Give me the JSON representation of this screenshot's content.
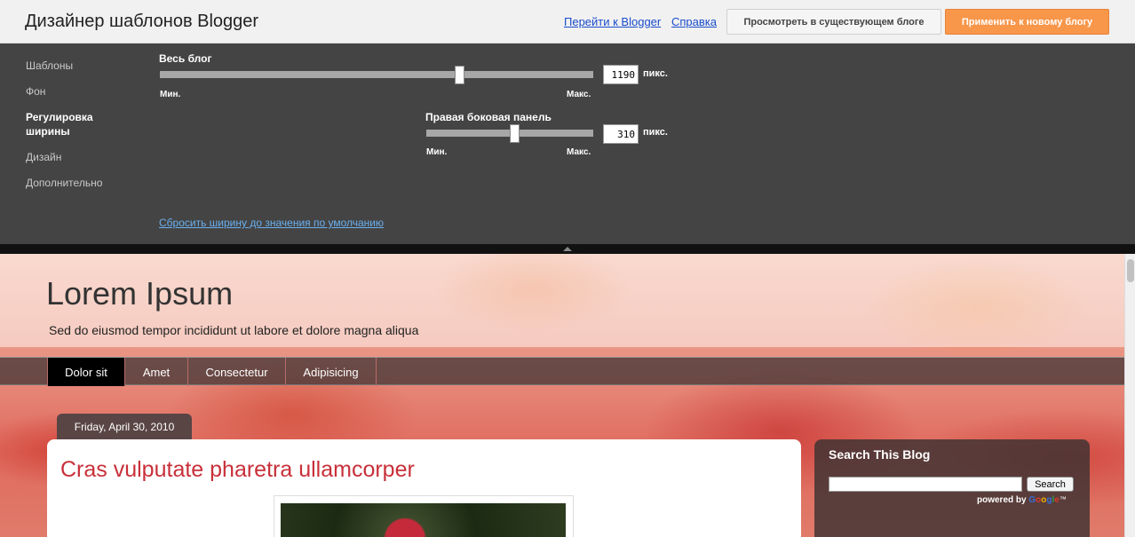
{
  "app": {
    "title_main": "Дизайнер шаблонов",
    "title_brand": "Blogger",
    "link_goto": "Перейти к Blogger",
    "link_help": "Справка",
    "btn_view": "Просмотреть в существующем блоге",
    "btn_apply": "Применить к новому блогу"
  },
  "sidebar": {
    "items": [
      {
        "label": "Шаблоны",
        "active": false
      },
      {
        "label": "Фон",
        "active": false
      },
      {
        "label": "Регулировка ширины",
        "active": true
      },
      {
        "label": "Дизайн",
        "active": false
      },
      {
        "label": "Дополнительно",
        "active": false
      }
    ]
  },
  "controls": {
    "whole_blog": {
      "label": "Весь блог",
      "value": "1190",
      "unit": "пикс.",
      "min": "Мин.",
      "max": "Макс."
    },
    "right_sidebar": {
      "label": "Правая боковая панель",
      "value": "310",
      "unit": "пикс.",
      "min": "Мин.",
      "max": "Макс."
    },
    "reset_link": "Сбросить ширину до значения по умолчанию"
  },
  "blog": {
    "title": "Lorem Ipsum",
    "description": "Sed do eiusmod tempor incididunt ut labore et dolore magna aliqua",
    "tabs": [
      "Dolor sit",
      "Amet",
      "Consectetur",
      "Adipisicing"
    ],
    "date": "Friday, April 30, 2010",
    "post_title": "Cras vulputate pharetra ullamcorper",
    "widget_title": "Search This Blog",
    "search_button": "Search",
    "powered_by": "powered by",
    "google": "Google",
    "tm": "™"
  },
  "colors": {
    "accent_orange": "#f8964a",
    "panel_bg": "#444444",
    "post_title": "#c8303a",
    "link_blue": "#1a4dcc"
  }
}
